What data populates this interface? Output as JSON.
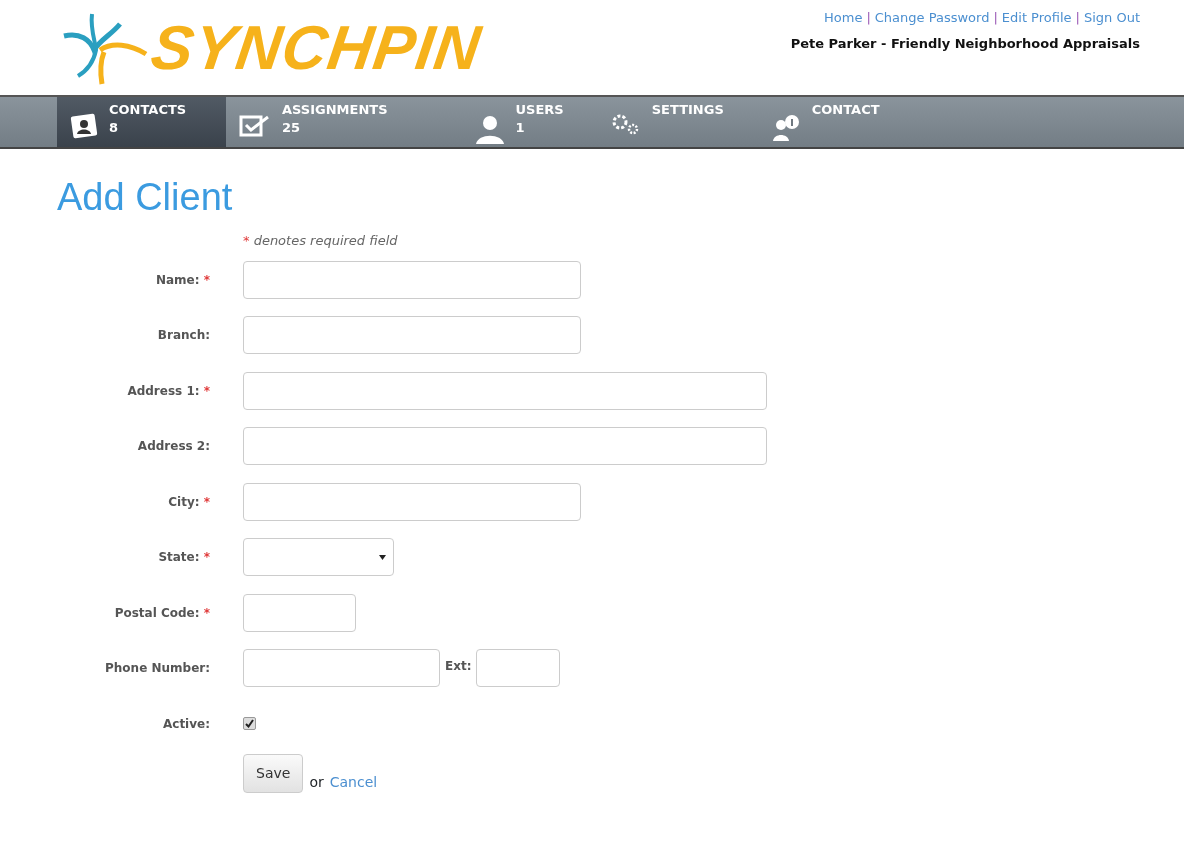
{
  "logo": {
    "text": "SYNCHPIN"
  },
  "top_links": [
    {
      "label": "Home"
    },
    {
      "separator": "|",
      "label": "Change Password"
    },
    {
      "separator": "|",
      "label": "Edit Profile"
    },
    {
      "separator": "|",
      "label": "Sign Out"
    }
  ],
  "user_line": "Pete Parker - Friendly Neighborhood Appraisals",
  "nav": [
    {
      "label": "CONTACTS",
      "count": "8",
      "selected": true
    },
    {
      "label": "ASSIGNMENTS",
      "count": "25",
      "selected": false
    },
    {
      "label": "USERS",
      "count": "1",
      "selected": false
    },
    {
      "label": "SETTINGS",
      "selected": false
    },
    {
      "label": "CONTACT",
      "selected": false
    }
  ],
  "page_title": "Add Client",
  "legend": {
    "mark": "*",
    "text": "denotes required field"
  },
  "fields": [
    {
      "kind": "text",
      "label": "Name:",
      "required_mark": "*"
    },
    {
      "kind": "text",
      "label": "Branch:"
    },
    {
      "kind": "text",
      "label": "Address 1:",
      "required_mark": "*"
    },
    {
      "kind": "text",
      "label": "Address 2:"
    },
    {
      "kind": "text",
      "label": "City:",
      "required_mark": "*"
    },
    {
      "kind": "select",
      "label": "State:",
      "required_mark": "*"
    },
    {
      "kind": "text",
      "label": "Postal Code:",
      "required_mark": "*"
    },
    {
      "kind": "phone",
      "label": "Phone Number:",
      "ext_label": "Ext:"
    },
    {
      "kind": "checkbox",
      "label": "Active:",
      "checked": true
    }
  ],
  "actions": {
    "save": "Save",
    "or": "or",
    "cancel": "Cancel"
  }
}
